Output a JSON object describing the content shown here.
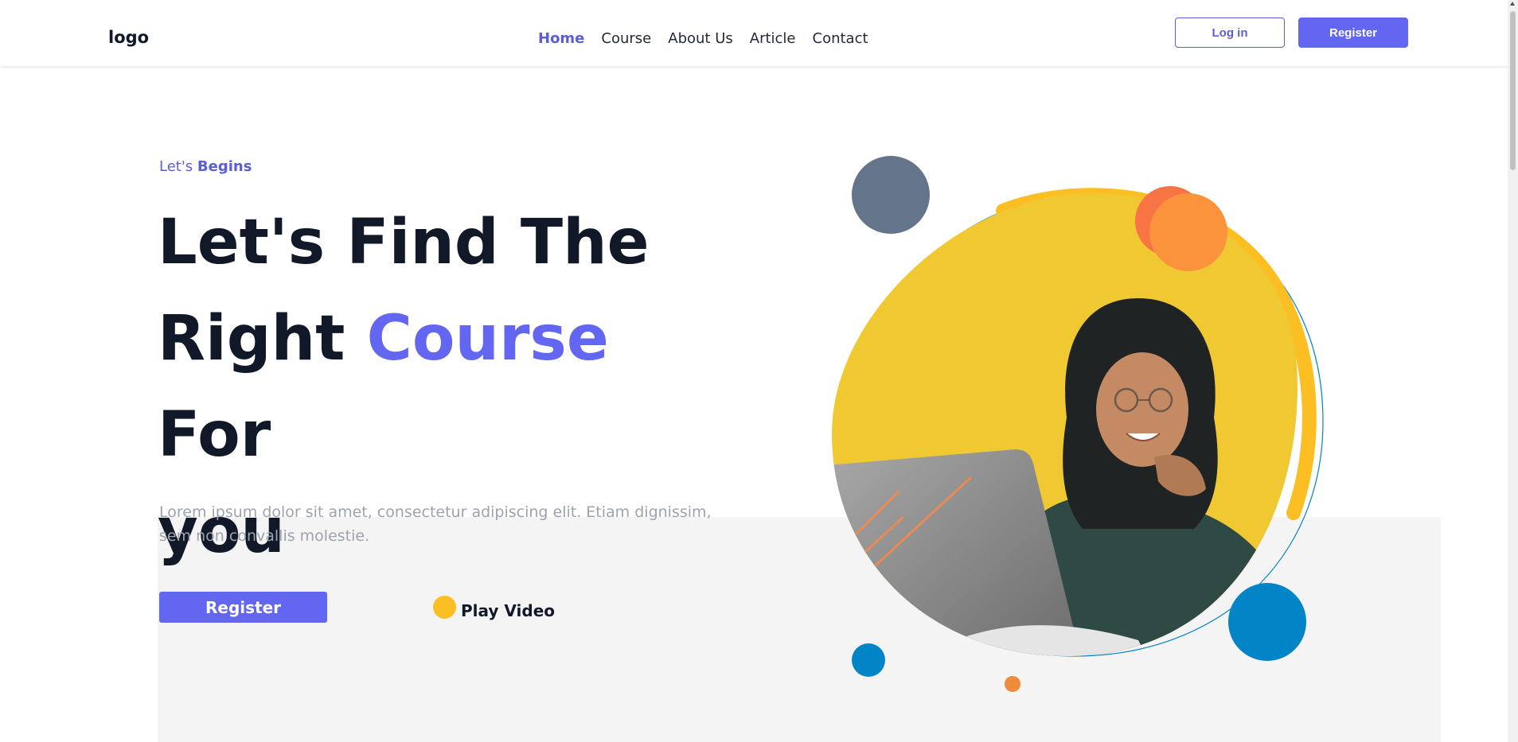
{
  "nav": {
    "logo": "logo",
    "links": [
      "Home",
      "Course",
      "About Us",
      "Article",
      "Contact"
    ],
    "active": "Home",
    "login_label": "Log in",
    "register_label": "Register"
  },
  "hero": {
    "eyebrow_prefix": "Let's",
    "eyebrow_strong": "Begins",
    "title_line1": "Let's Find The",
    "title_pre": "Right",
    "title_accent": "Course",
    "title_post": "For",
    "title_line3": "you",
    "description": "Lorem ipsum dolor sit amet, consectetur adipiscing elit. Etiam dignissim, sem non convallis molestie.",
    "register_label": "Register",
    "play_label": "Play Video"
  },
  "colors": {
    "primary": "#6366f1",
    "heading": "#111827",
    "muted": "#9ca3af",
    "yellow": "#f0c832",
    "orange": "#fb923c",
    "blue": "#0284c7",
    "slate": "#64748b"
  },
  "icons": [
    "play-icon"
  ]
}
